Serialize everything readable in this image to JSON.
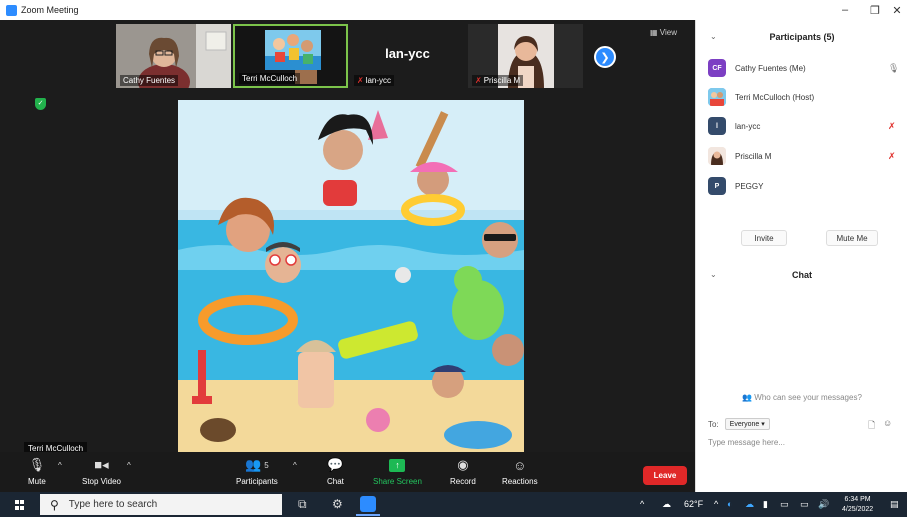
{
  "window": {
    "title": "Zoom Meeting",
    "controls": [
      "–",
      "❐",
      "✕"
    ]
  },
  "tiles": [
    {
      "name": "Cathy Fuentes",
      "muted": false
    },
    {
      "name": "Terri McCulloch",
      "muted": false
    },
    {
      "name": "lan-ycc",
      "big_name": "lan-ycc",
      "muted": true
    },
    {
      "name": "Priscilla M",
      "muted": true
    }
  ],
  "view_button": "View",
  "active_speaker_label": "Terri McCulloch",
  "toolbar": {
    "mute": "Mute",
    "stop_video": "Stop Video",
    "participants": "Participants",
    "participants_count": "5",
    "chat": "Chat",
    "share_screen": "Share Screen",
    "record": "Record",
    "reactions": "Reactions",
    "leave": "Leave"
  },
  "participants_panel": {
    "title": "Participants (5)",
    "participants": [
      {
        "initials": "CF",
        "name": "Cathy Fuentes (Me)",
        "color": "#7c3fc3"
      },
      {
        "initials": "",
        "name": "Terri McCulloch (Host)",
        "color": "#5aa4e8"
      },
      {
        "initials": "l",
        "name": "lan-ycc",
        "color": "#344b6b"
      },
      {
        "initials": "",
        "name": "Priscilla M",
        "color": "#b5765b"
      },
      {
        "initials": "P",
        "name": "PEGGY",
        "color": "#344b6b"
      }
    ],
    "invite": "Invite",
    "mute_me": "Mute Me"
  },
  "chat_panel": {
    "title": "Chat",
    "who_can_see": "Who can see your messages?",
    "to_label": "To:",
    "to_value": "Everyone ▾",
    "placeholder": "Type message here..."
  },
  "taskbar": {
    "search_placeholder": "Type here to search",
    "temperature": "62°F",
    "time": "6:34 PM",
    "date": "4/25/2022"
  },
  "colors": {
    "accent": "#2d8cff",
    "leave": "#e02828",
    "share": "#1db954",
    "mute_red": "#e0302c"
  }
}
